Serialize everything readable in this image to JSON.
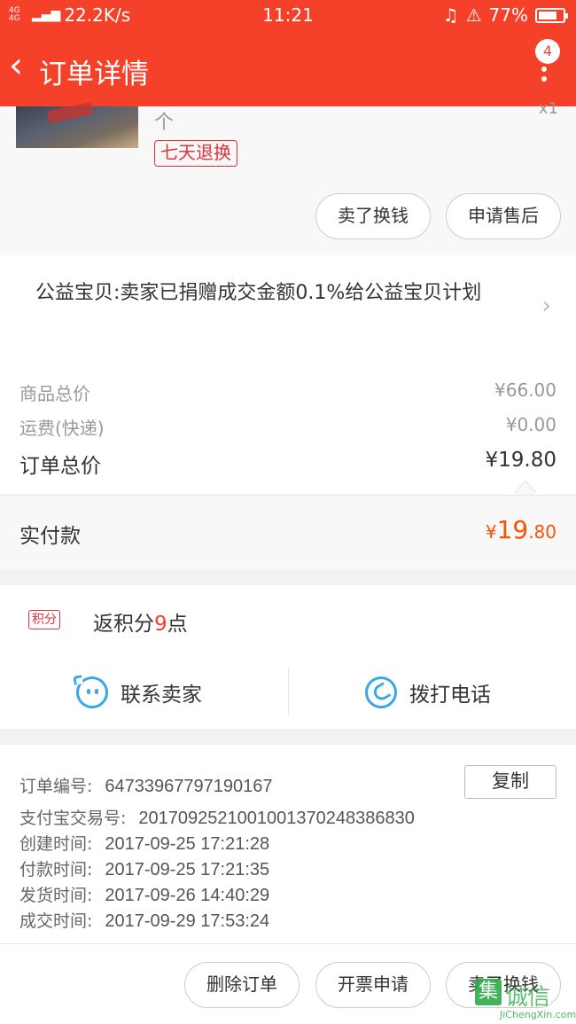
{
  "status_bar": {
    "network": "4G 4G",
    "speed": "22.2K/s",
    "time": "11:21",
    "battery": "77%",
    "battery_level": 0.77
  },
  "nav": {
    "back_glyph": "‹",
    "title": "订单详情",
    "badge": "4"
  },
  "product": {
    "unit": "个",
    "qty": "x1",
    "tag": "七天退换",
    "sell_button": "卖了换钱",
    "after_sale_button": "申请售后"
  },
  "charity": {
    "text": "公益宝贝:卖家已捐赠成交金额0.1%给公益宝贝计划"
  },
  "prices": {
    "goods_label": "商品总价",
    "goods_value": "¥66.00",
    "shipping_label": "运费(快递)",
    "shipping_value": "¥0.00",
    "total_label": "订单总价",
    "total_value": "¥19.80",
    "paid_label": "实付款",
    "paid_currency": "¥",
    "paid_int": "19",
    "paid_dec": ".80"
  },
  "points": {
    "badge": "积分",
    "prefix": "返积分",
    "num": "9",
    "suffix": "点"
  },
  "contact": {
    "seller": "联系卖家",
    "phone": "拨打电话"
  },
  "order_info": {
    "order_no_label": "订单编号:",
    "order_no": "64733967797190167",
    "copy": "复制",
    "alipay_label": "支付宝交易号:",
    "alipay": "2017092521001001370248386830",
    "created_label": "创建时间:",
    "created": "2017-09-25 17:21:28",
    "paid_label": "付款时间:",
    "paid": "2017-09-25 17:21:35",
    "shipped_label": "发货时间:",
    "shipped": "2017-09-26 14:40:29",
    "done_label": "成交时间:",
    "done": "2017-09-29 17:53:24"
  },
  "bottom": {
    "delete": "删除订单",
    "invoice": "开票申请",
    "sell": "卖了换钱"
  },
  "watermark": {
    "box": "集",
    "cn": "诚信",
    "en": "JiChengXin.com"
  },
  "colors": {
    "brand": "#f5402a",
    "accent": "#ff5000",
    "link_blue": "#3aa7e8"
  }
}
